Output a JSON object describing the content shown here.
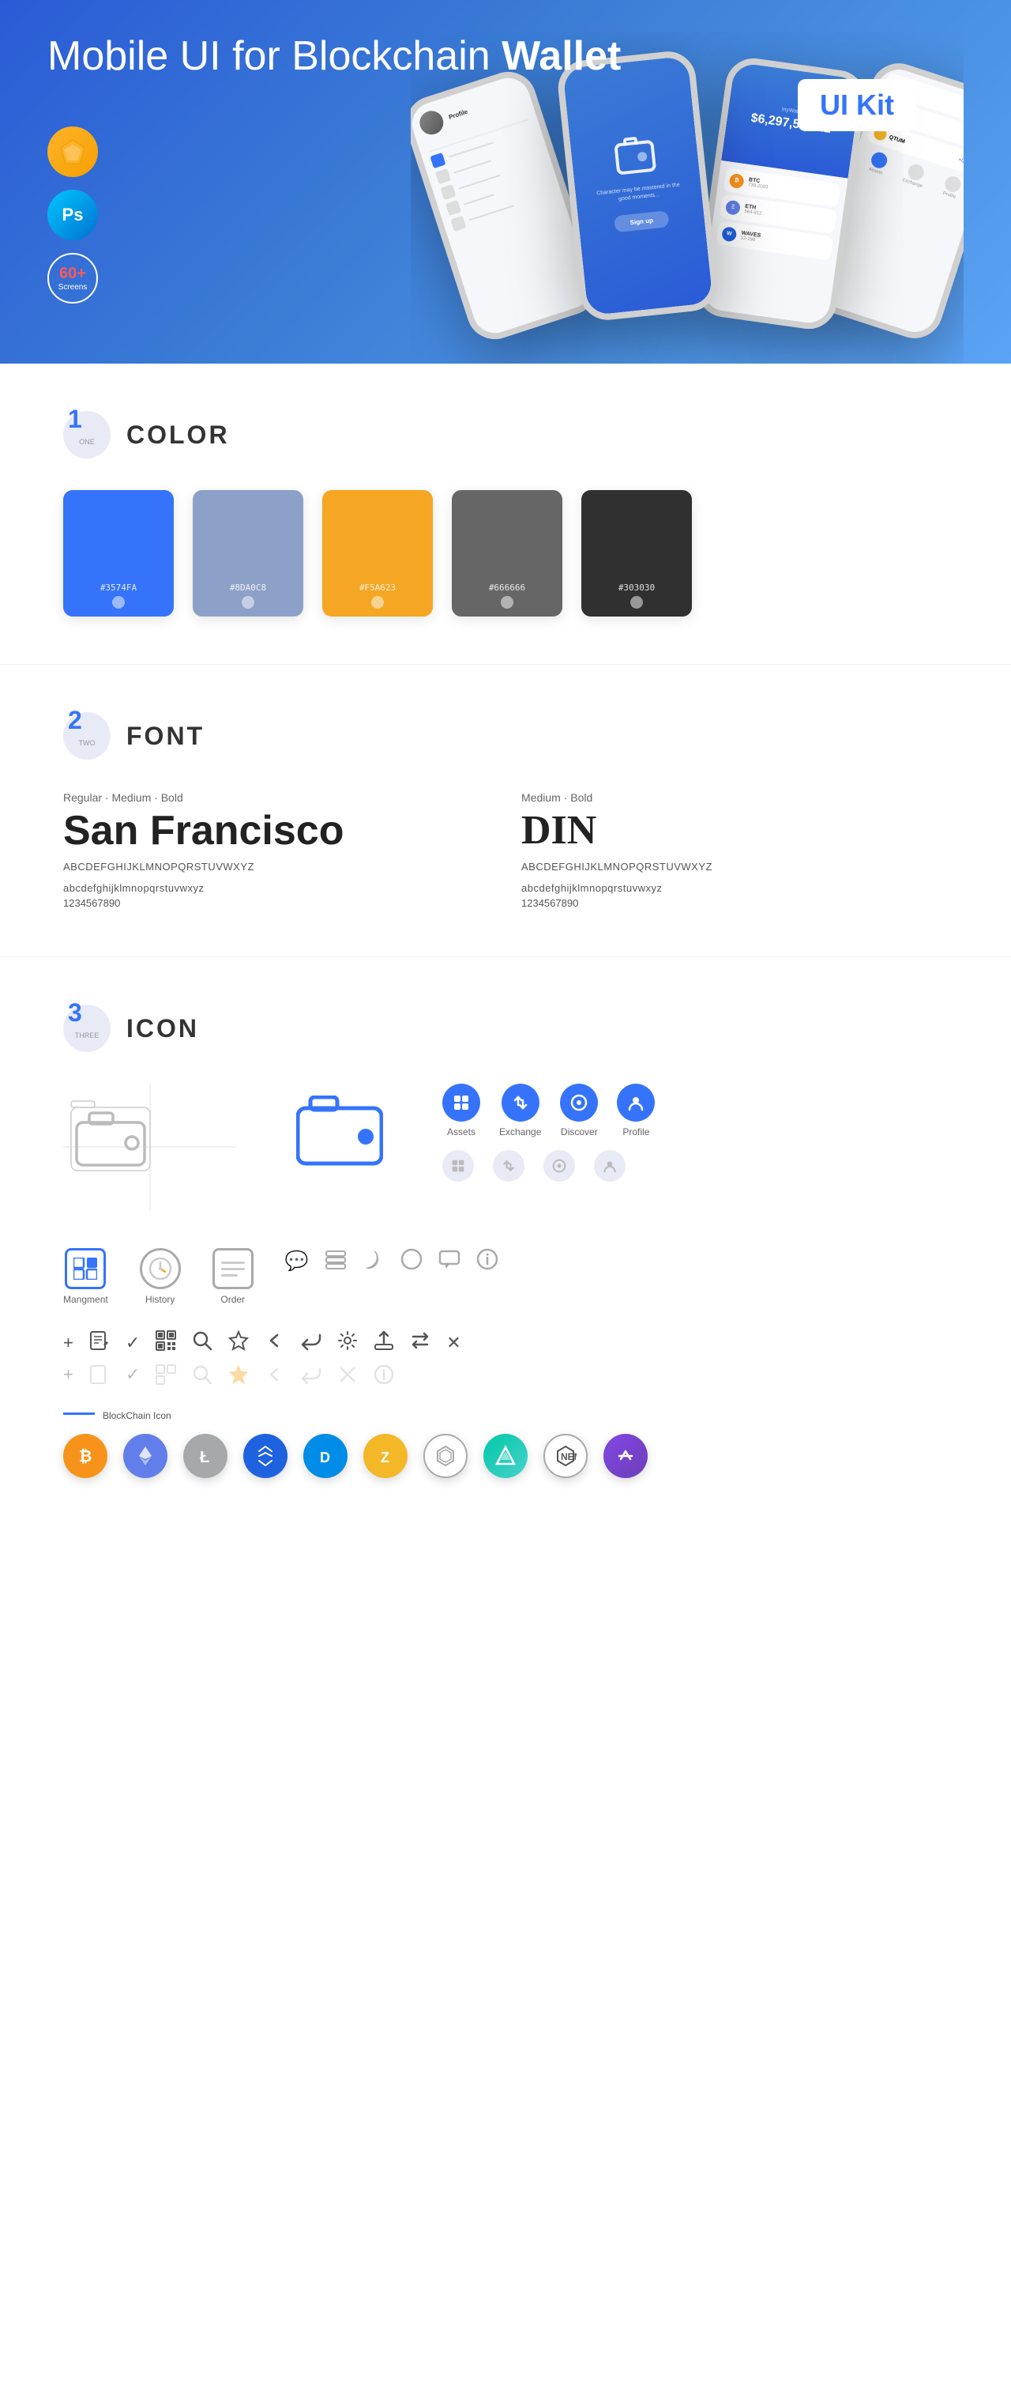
{
  "hero": {
    "title": "Mobile UI for Blockchain ",
    "title_bold": "Wallet",
    "ui_kit_badge": "UI Kit",
    "badges": {
      "sketch": "Sketch",
      "ps": "Ps",
      "screens": "60+",
      "screens_sub": "Screens"
    }
  },
  "sections": {
    "color": {
      "number": "1",
      "word": "ONE",
      "title": "COLOR",
      "swatches": [
        {
          "color": "#3574FA",
          "code": "#3574FA"
        },
        {
          "color": "#8DA0C8",
          "code": "#8DA0C8"
        },
        {
          "color": "#F5A623",
          "code": "#F5A623"
        },
        {
          "color": "#666666",
          "code": "#666666"
        },
        {
          "color": "#303030",
          "code": "#303030"
        }
      ]
    },
    "font": {
      "number": "2",
      "word": "TWO",
      "title": "FONT",
      "font1": {
        "meta": "Regular · Medium · Bold",
        "name": "San Francisco",
        "abc_upper": "ABCDEFGHIJKLMNOPQRSTUVWXYZ",
        "abc_lower": "abcdefghijklmnopqrstuvwxyz",
        "numbers": "1234567890"
      },
      "font2": {
        "meta": "Medium · Bold",
        "name": "DIN",
        "abc_upper": "ABCDEFGHIJKLMNOPQRSTUVWXYZ",
        "abc_lower": "abcdefghijklmnopqrstuvwxyz",
        "numbers": "1234567890"
      }
    },
    "icon": {
      "number": "3",
      "word": "THREE",
      "title": "ICON",
      "nav_icons": [
        {
          "label": "Assets",
          "color": "#3574FA"
        },
        {
          "label": "Exchange",
          "color": "#3574FA"
        },
        {
          "label": "Discover",
          "color": "#3574FA"
        },
        {
          "label": "Profile",
          "color": "#3574FA"
        }
      ],
      "bottom_icons": [
        {
          "label": "Mangment"
        },
        {
          "label": "History"
        },
        {
          "label": "Order"
        }
      ],
      "blockchain_label": "BlockChain Icon",
      "crypto_coins": [
        {
          "symbol": "₿",
          "color": "#F7931A",
          "label": "Bitcoin"
        },
        {
          "symbol": "Ξ",
          "color": "#627EEA",
          "label": "Ethereum"
        },
        {
          "symbol": "Ł",
          "color": "#A6A9AA",
          "label": "Litecoin"
        },
        {
          "symbol": "◆",
          "color": "#1E62E0",
          "label": "Waves"
        },
        {
          "symbol": "D",
          "color": "#008CE7",
          "label": "Dash"
        },
        {
          "symbol": "Z",
          "color": "#F4B728",
          "label": "Zcash"
        },
        {
          "symbol": "◈",
          "color": "#242424",
          "label": "IOTA"
        },
        {
          "symbol": "▲",
          "color": "#F70000",
          "label": "Ark"
        },
        {
          "symbol": "N",
          "color": "#67B2E8",
          "label": "NEM"
        },
        {
          "symbol": "⬡",
          "color": "#8247E5",
          "label": "Matic"
        }
      ]
    }
  }
}
